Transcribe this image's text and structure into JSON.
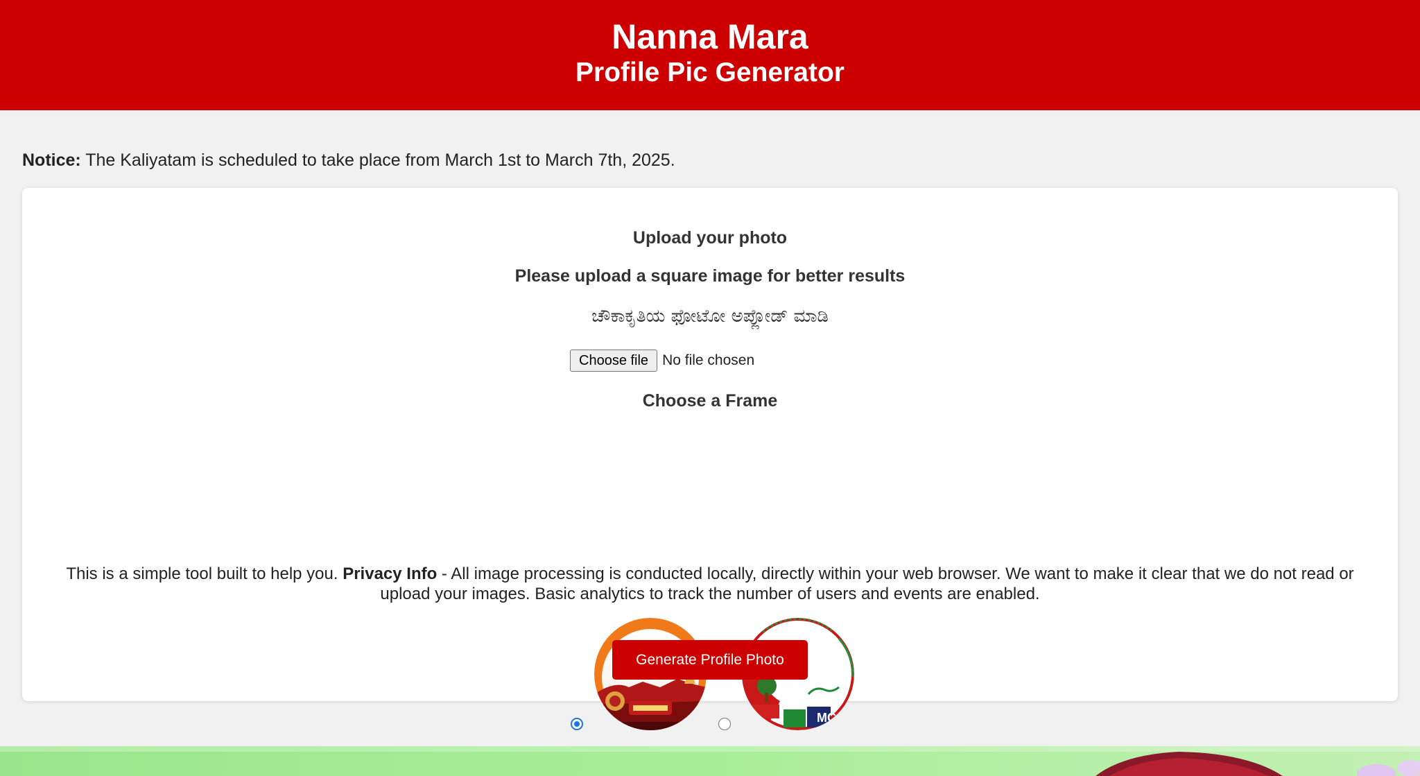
{
  "header": {
    "title": "Nanna Mara",
    "subtitle": "Profile Pic Generator"
  },
  "notice": {
    "label": "Notice:",
    "text": " The Kaliyatam is scheduled to take place from March 1st to March 7th, 2025."
  },
  "upload": {
    "heading": "Upload your photo",
    "hint": "Please upload a square image for better results",
    "hint_kannada": "ಚೌಕಾಕೃತಿಯ ಫೋಟೋ ಅಪ್ಲೋಡ್ ಮಾಡಿ",
    "choose_file_label": "Choose file",
    "file_status": "No file chosen"
  },
  "frames": {
    "heading": "Choose a Frame",
    "options": [
      {
        "id": "frame-1",
        "selected": true
      },
      {
        "id": "frame-2",
        "selected": false
      }
    ]
  },
  "privacy": {
    "intro": "This is a simple tool built to help you. ",
    "label": "Privacy Info",
    "text": " - All image processing is conducted locally, directly within your web browser. We want to make it clear that we do not read or upload your images. Basic analytics to track the number of users and events are enabled."
  },
  "actions": {
    "generate_label": "Generate Profile Photo"
  },
  "colors": {
    "brand_red": "#cc0000",
    "radio_blue": "#1a73e8",
    "page_bg": "#f1f1f1"
  }
}
